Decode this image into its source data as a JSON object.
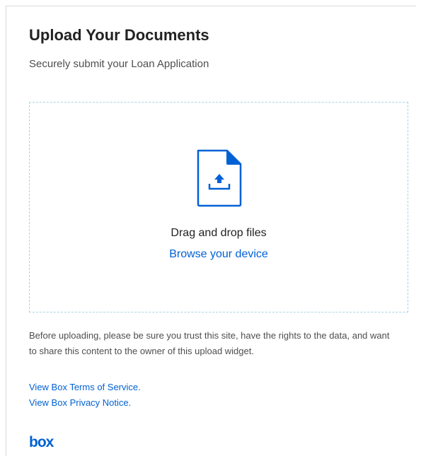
{
  "header": {
    "title": "Upload Your Documents",
    "subtitle": "Securely submit your Loan Application"
  },
  "dropzone": {
    "icon": "file-upload-icon",
    "instruction": "Drag and drop files",
    "browse_label": "Browse your device"
  },
  "disclaimer": {
    "text": "Before uploading, please be sure you trust this site, have the rights to the data, and want to share this content to the owner of this upload widget."
  },
  "links": {
    "terms": "View Box Terms of Service.",
    "privacy": "View Box Privacy Notice."
  },
  "branding": {
    "logo": "box"
  },
  "colors": {
    "accent": "#0061d5",
    "dropzone_border": "#a9d4e6",
    "title": "#222222",
    "body_text": "#4e4e4e"
  }
}
